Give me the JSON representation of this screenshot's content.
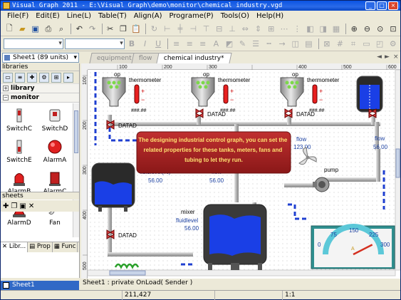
{
  "window": {
    "title": "Visual Graph 2011 - E:\\Visual Graph\\demo\\monitor\\chemical industry.vgd",
    "minimize": "_",
    "maximize": "□",
    "close": "×"
  },
  "menu": [
    "File(F)",
    "Edit(E)",
    "Line(L)",
    "Table(T)",
    "Align(A)",
    "Programe(P)",
    "Tools(O)",
    "Help(H)"
  ],
  "sheet_combo": "Sheet1 (89 units)",
  "tabs": [
    {
      "label": "equipment",
      "active": false
    },
    {
      "label": "flow",
      "active": false
    },
    {
      "label": "chemical industry*",
      "active": true
    }
  ],
  "tab_nav": {
    "prev": "◄",
    "next": "►",
    "close": "×"
  },
  "left_panel": {
    "header": "libraries",
    "categories": [
      "library",
      "monitor"
    ],
    "items": [
      "SwitchC",
      "SwitchD",
      "SwitchE",
      "AlarmA",
      "AlarmB",
      "AlarmC",
      "AlarmD",
      "Fan"
    ],
    "panel_tabs": [
      "Libr...",
      "Prop",
      "Func"
    ],
    "sheets_header": "sheets",
    "sheet_name": "Sheet1"
  },
  "ruler": {
    "x_ticks": [
      "100",
      "200",
      "300",
      "400",
      "500",
      "600"
    ],
    "y_ticks": [
      "100",
      "200",
      "300",
      "400",
      "500"
    ]
  },
  "diagram": {
    "tanks": [
      {
        "label": "op",
        "meter": "thermometer",
        "readout": "###.##",
        "valve": "DATAD"
      },
      {
        "label": "op",
        "meter": "thermometer",
        "readout": "###.##",
        "valve": "DATAD"
      },
      {
        "label": "op",
        "meter": "thermometer",
        "readout": "###.##",
        "valve": "DATAD"
      }
    ],
    "left_tank": {
      "label": "fluidlevel(%)",
      "value": "56.00",
      "valve": "DATAD"
    },
    "flow_left": {
      "label": "flow",
      "value": "56.00"
    },
    "flow_mid": {
      "label": "flow",
      "value": "123.00"
    },
    "flow_right": {
      "label": "flow",
      "value": "56.00"
    },
    "mixer": {
      "label": "mixer",
      "level_label": "fluidlevel",
      "level_value": "56.00"
    },
    "pump": "pump",
    "callout": "The designing industrial control graph, you can set the related properties for these tanks, meters, fans and tubing to let they run.",
    "gauge": {
      "ticks": [
        "0",
        "75",
        "150",
        "225",
        "300"
      ],
      "unit": "A",
      "value": 255,
      "max": 300
    }
  },
  "status": "Sheet1 : private OnLoad( Sender )",
  "bottom": {
    "coords": "211,427",
    "zoom": "1:1"
  },
  "colors": {
    "pipe": "#b8b8b8",
    "tank_body": "#c8c8c8",
    "fluid": "#1a3fe6",
    "callout_bg": "#a82424",
    "callout_text": "#ffffff",
    "dashed_pipe": "#1f3fd0",
    "gauge_face": "#f4f4f4",
    "gauge_arc": "#5cc8d8",
    "gauge_needle": "#d43020"
  }
}
